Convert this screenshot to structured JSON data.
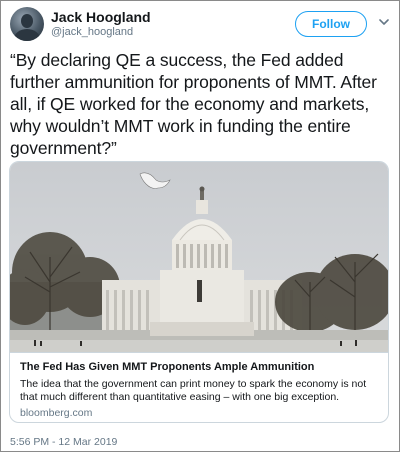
{
  "author": {
    "name": "Jack Hoogland",
    "handle": "@jack_hoogland"
  },
  "actions": {
    "follow_label": "Follow"
  },
  "tweet": {
    "text": "“By declaring QE a success, the Fed added further ammunition for proponents of MMT. After all, if QE worked for the economy and markets, why wouldn’t MMT work in funding the entire government?”",
    "timestamp": "5:56 PM - 12 Mar 2019"
  },
  "card": {
    "title": "The Fed Has Given MMT Proponents Ample Ammunition",
    "description": "The idea that the government can print money to spark the economy is not that much different than quantitative easing – with one big exception.",
    "domain": "bloomberg.com"
  },
  "colors": {
    "accent": "#1da1f2",
    "secondary_text": "#657786",
    "border": "#ccd6dd"
  },
  "icons": {
    "menu": "chevron-down-icon"
  }
}
